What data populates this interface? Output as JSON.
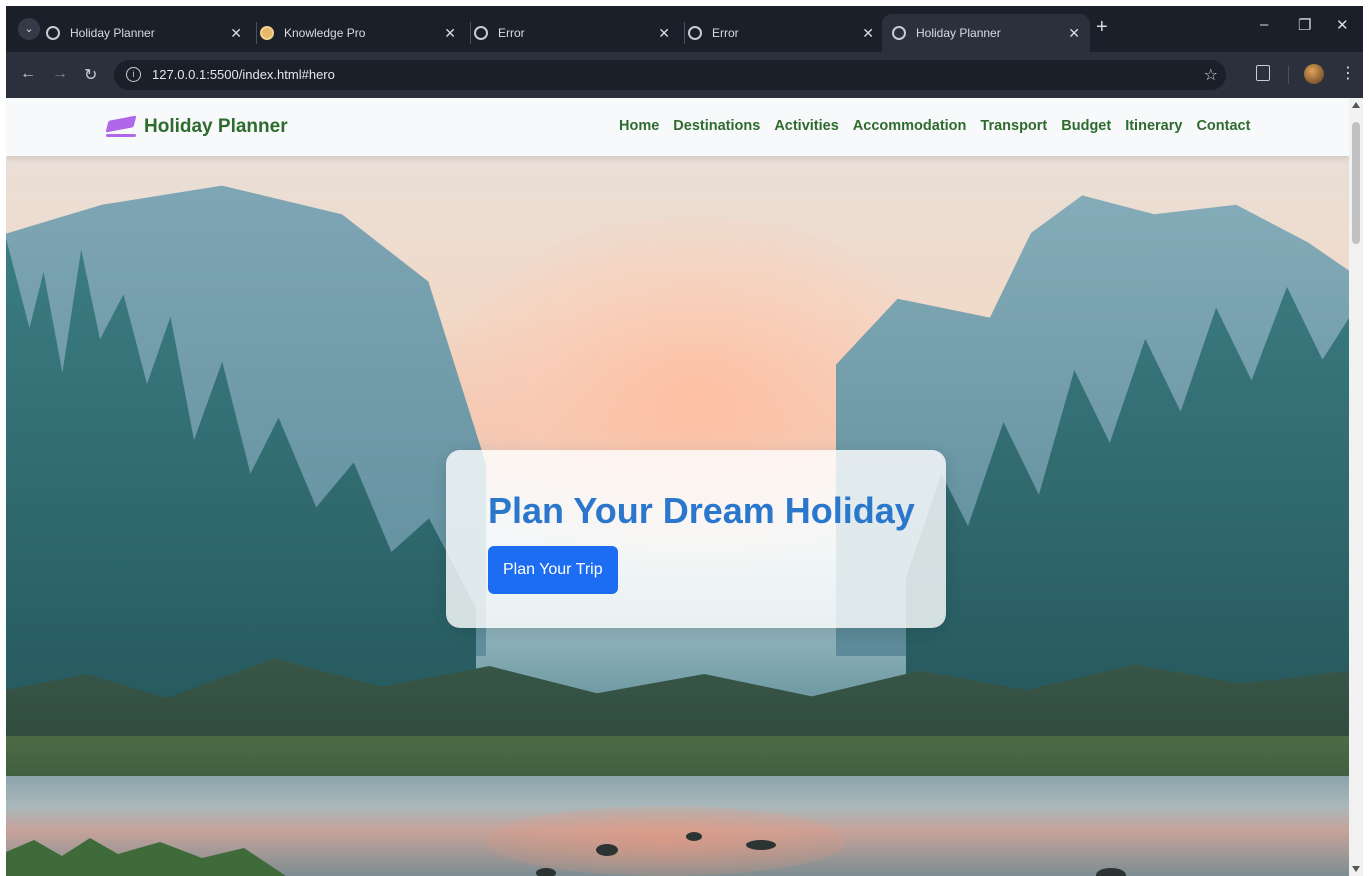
{
  "browser": {
    "tabs": [
      {
        "label": "Holiday Planner",
        "active": false
      },
      {
        "label": "Knowledge Pro",
        "active": false
      },
      {
        "label": "Error",
        "active": false
      },
      {
        "label": "Error",
        "active": false
      },
      {
        "label": "Holiday Planner",
        "active": true
      }
    ],
    "url": "127.0.0.1:5500/index.html#hero"
  },
  "site": {
    "brand": "Holiday Planner",
    "nav": [
      "Home",
      "Destinations",
      "Activities",
      "Accommodation",
      "Transport",
      "Budget",
      "Itinerary",
      "Contact"
    ]
  },
  "hero": {
    "title": "Plan Your Dream Holiday",
    "button_label": "Plan Your Trip"
  },
  "colors": {
    "brand_green": "#2e6b2e",
    "hero_title_blue": "#2b77cc",
    "button_blue": "#1d6df2",
    "logo_purple": "#b067e8"
  }
}
